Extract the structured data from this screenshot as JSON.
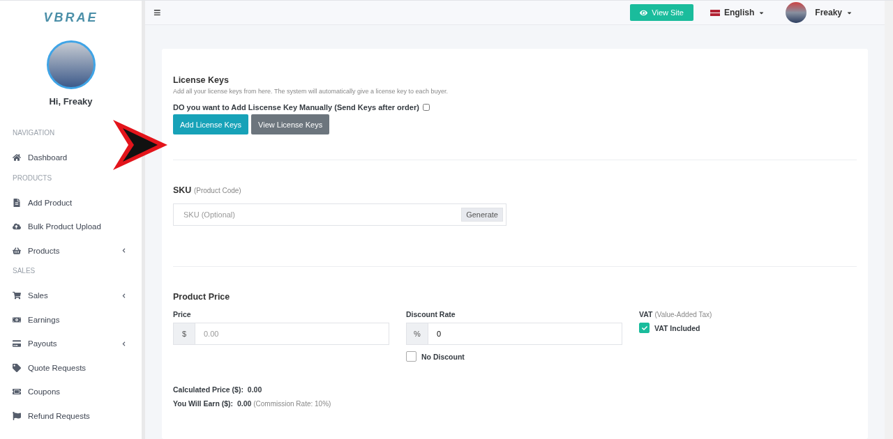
{
  "sidebar": {
    "logo": "VBRAE",
    "greeting": "Hi, Freaky",
    "items": [
      {
        "kind": "heading",
        "label": "NAVIGATION"
      },
      {
        "kind": "link",
        "label": "Dashboard",
        "submenu": false
      },
      {
        "kind": "heading",
        "label": "PRODUCTS"
      },
      {
        "kind": "link",
        "label": "Add Product",
        "submenu": false
      },
      {
        "kind": "link",
        "label": "Bulk Product Upload",
        "submenu": false
      },
      {
        "kind": "link",
        "label": "Products",
        "submenu": true
      },
      {
        "kind": "heading",
        "label": "SALES"
      },
      {
        "kind": "link",
        "label": "Sales",
        "submenu": true
      },
      {
        "kind": "link",
        "label": "Earnings",
        "submenu": false
      },
      {
        "kind": "link",
        "label": "Payouts",
        "submenu": true
      },
      {
        "kind": "link",
        "label": "Quote Requests",
        "submenu": false
      },
      {
        "kind": "link",
        "label": "Coupons",
        "submenu": false
      },
      {
        "kind": "link",
        "label": "Refund Requests",
        "submenu": false
      }
    ]
  },
  "topbar": {
    "menu_glyph": "≡",
    "view_site": "View Site",
    "language": "English",
    "user": "Freaky"
  },
  "license": {
    "title": "License Keys",
    "description": "Add all your license keys from here. The system will automatically give a license key to each buyer.",
    "manual_label": "DO you want to Add Liscense Key Manually (Send Keys after order)",
    "manual_checked": false,
    "buttons": [
      "Add License Keys",
      "View License Keys"
    ]
  },
  "sku": {
    "title": "SKU",
    "hint": "(Product Code)",
    "placeholder": "SKU (Optional)",
    "generate": "Generate"
  },
  "price": {
    "title": "Product Price",
    "price_label": "Price",
    "currency": "$",
    "price_placeholder": "0.00",
    "discount_label": "Discount Rate",
    "percent": "%",
    "discount_value": "0",
    "no_discount": "No Discount",
    "no_discount_checked": false,
    "vat_label": "VAT",
    "vat_hint": "(Value-Added Tax)",
    "vat_included": "VAT Included",
    "vat_checked": true,
    "calculated_label": "Calculated Price ($):",
    "calculated_value": "0.00",
    "earn_label": "You Will Earn ($):",
    "earn_value": "0.00",
    "commission": "(Commission Rate:  10%)"
  }
}
